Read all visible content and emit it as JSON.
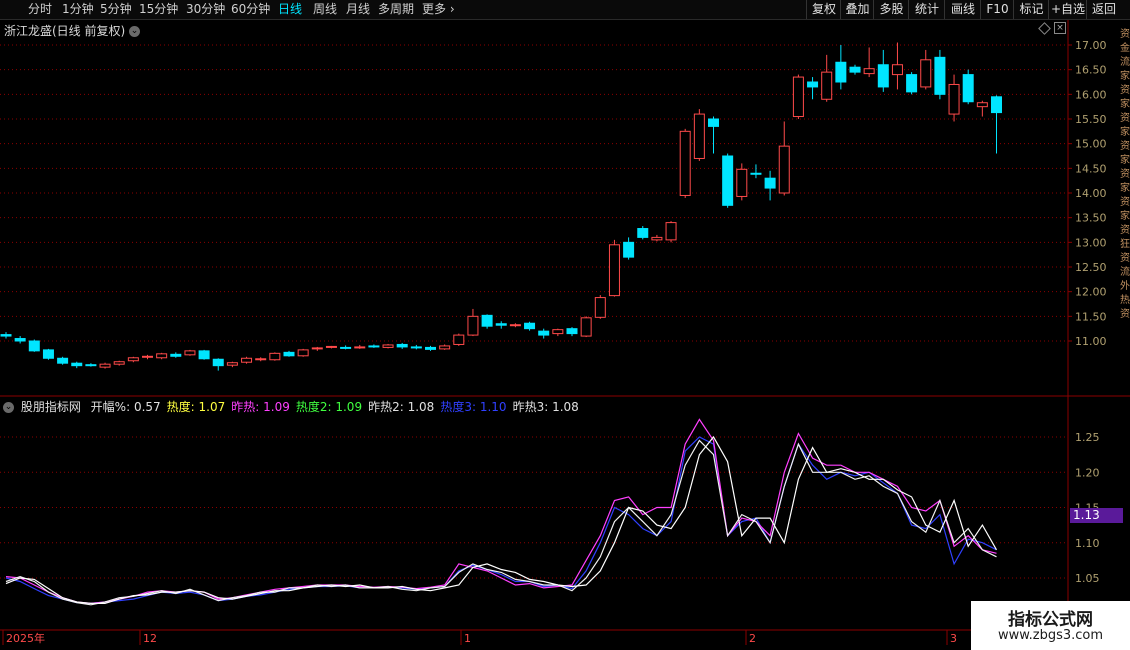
{
  "toolbar": {
    "tabs": [
      "分时",
      "1分钟",
      "5分钟",
      "15分钟",
      "30分钟",
      "60分钟",
      "日线",
      "周线",
      "月线",
      "多周期",
      "更多"
    ],
    "active_tab": "日线",
    "right_buttons": [
      "复权",
      "叠加",
      "多股",
      "统计",
      "画线",
      "F10",
      "标记",
      "+自选",
      "返回"
    ]
  },
  "title": "浙江龙盛(日线 前复权)",
  "indicator": {
    "name": "股朋指标网",
    "items": [
      {
        "label": "开幅%:",
        "value": "0.57",
        "color": "#e0e0e0"
      },
      {
        "label": "热度:",
        "value": "1.07",
        "color": "#ffff40"
      },
      {
        "label": "昨热:",
        "value": "1.09",
        "color": "#ff40ff"
      },
      {
        "label": "热度2:",
        "value": "1.09",
        "color": "#40ff40"
      },
      {
        "label": "昨热2:",
        "value": "1.08",
        "color": "#e0e0e0"
      },
      {
        "label": "热度3:",
        "value": "1.10",
        "color": "#3040ff"
      },
      {
        "label": "昨热3:",
        "value": "1.08",
        "color": "#e0e0e0"
      }
    ],
    "badge": "1.13"
  },
  "price_axis": [
    "17.00",
    "16.50",
    "16.00",
    "15.50",
    "15.00",
    "14.50",
    "14.00",
    "13.50",
    "13.00",
    "12.50",
    "12.00",
    "11.50",
    "11.00"
  ],
  "ind_axis": [
    "1.25",
    "1.20",
    "1.15",
    "1.10",
    "1.05"
  ],
  "date_axis": [
    "2025年",
    "12",
    "1",
    "2",
    "3"
  ],
  "right_strip": "资金流家资家资家资家资家资家资狂资流外热资",
  "watermark": {
    "line1": "指标公式网",
    "line2": "www.zbgs3.com"
  },
  "colors": {
    "up": "#ff4a4a",
    "down": "#00e5ff",
    "grid": "#8b0000",
    "axis": "#b0a070"
  },
  "chart_data": [
    {
      "type": "candlestick",
      "title": "浙江龙盛(日线 前复权)",
      "ylim": [
        10.0,
        17.2
      ],
      "candles": [
        [
          11.13,
          11.1,
          11.18,
          11.05
        ],
        [
          11.05,
          11.0,
          11.1,
          10.95
        ],
        [
          11.0,
          10.8,
          11.03,
          10.78
        ],
        [
          10.82,
          10.65,
          10.84,
          10.62
        ],
        [
          10.65,
          10.55,
          10.68,
          10.52
        ],
        [
          10.55,
          10.5,
          10.58,
          10.45
        ],
        [
          10.52,
          10.51,
          10.55,
          10.48
        ],
        [
          10.47,
          10.53,
          10.56,
          10.44
        ],
        [
          10.53,
          10.58,
          10.6,
          10.5
        ],
        [
          10.6,
          10.66,
          10.68,
          10.57
        ],
        [
          10.67,
          10.69,
          10.72,
          10.63
        ],
        [
          10.66,
          10.74,
          10.76,
          10.63
        ],
        [
          10.73,
          10.69,
          10.77,
          10.66
        ],
        [
          10.72,
          10.8,
          10.82,
          10.7
        ],
        [
          10.8,
          10.64,
          10.82,
          10.62
        ],
        [
          10.63,
          10.5,
          10.65,
          10.4
        ],
        [
          10.51,
          10.56,
          10.58,
          10.47
        ],
        [
          10.57,
          10.65,
          10.68,
          10.54
        ],
        [
          10.62,
          10.64,
          10.67,
          10.59
        ],
        [
          10.62,
          10.75,
          10.77,
          10.6
        ],
        [
          10.77,
          10.7,
          10.8,
          10.68
        ],
        [
          10.7,
          10.82,
          10.84,
          10.68
        ],
        [
          10.84,
          10.86,
          10.88,
          10.8
        ],
        [
          10.88,
          10.89,
          10.9,
          10.85
        ],
        [
          10.87,
          10.86,
          10.91,
          10.83
        ],
        [
          10.86,
          10.88,
          10.92,
          10.84
        ],
        [
          10.9,
          10.89,
          10.93,
          10.86
        ],
        [
          10.87,
          10.92,
          10.94,
          10.85
        ],
        [
          10.93,
          10.88,
          10.96,
          10.84
        ],
        [
          10.88,
          10.86,
          10.92,
          10.83
        ],
        [
          10.87,
          10.83,
          10.9,
          10.8
        ],
        [
          10.84,
          10.9,
          10.93,
          10.82
        ],
        [
          10.93,
          11.12,
          11.15,
          10.9
        ],
        [
          11.12,
          11.5,
          11.65,
          11.1
        ],
        [
          11.52,
          11.3,
          11.54,
          11.25
        ],
        [
          11.35,
          11.32,
          11.4,
          11.25
        ],
        [
          11.32,
          11.33,
          11.36,
          11.28
        ],
        [
          11.36,
          11.25,
          11.39,
          11.21
        ],
        [
          11.2,
          11.12,
          11.25,
          11.05
        ],
        [
          11.15,
          11.23,
          11.25,
          11.1
        ],
        [
          11.25,
          11.15,
          11.28,
          11.1
        ],
        [
          11.1,
          11.47,
          11.5,
          11.08
        ],
        [
          11.48,
          11.88,
          11.93,
          11.45
        ],
        [
          11.92,
          12.95,
          13.05,
          11.9
        ],
        [
          13.0,
          12.7,
          13.1,
          12.65
        ],
        [
          13.28,
          13.1,
          13.33,
          13.06
        ],
        [
          13.05,
          13.1,
          13.15,
          13.02
        ],
        [
          13.05,
          13.4,
          13.43,
          13.0
        ],
        [
          13.95,
          15.25,
          15.3,
          13.9
        ],
        [
          14.7,
          15.6,
          15.7,
          14.65
        ],
        [
          15.5,
          15.35,
          15.55,
          14.8
        ],
        [
          14.75,
          13.75,
          14.8,
          13.7
        ],
        [
          13.93,
          14.48,
          14.6,
          13.85
        ],
        [
          14.4,
          14.38,
          14.58,
          14.3
        ],
        [
          14.3,
          14.1,
          14.45,
          13.85
        ],
        [
          14.0,
          14.95,
          15.45,
          13.95
        ],
        [
          15.55,
          16.35,
          16.4,
          15.5
        ],
        [
          16.25,
          16.15,
          16.35,
          15.9
        ],
        [
          15.9,
          16.45,
          16.8,
          15.85
        ],
        [
          16.65,
          16.25,
          17.0,
          16.1
        ],
        [
          16.55,
          16.45,
          16.6,
          16.4
        ],
        [
          16.42,
          16.52,
          16.95,
          16.35
        ],
        [
          16.6,
          16.15,
          16.9,
          16.05
        ],
        [
          16.4,
          16.6,
          17.05,
          16.1
        ],
        [
          16.4,
          16.05,
          16.45,
          16.0
        ],
        [
          16.15,
          16.7,
          16.9,
          16.1
        ],
        [
          16.75,
          16.0,
          16.9,
          15.9
        ],
        [
          15.6,
          16.2,
          16.4,
          15.45
        ],
        [
          16.4,
          15.85,
          16.5,
          15.8
        ],
        [
          15.75,
          15.83,
          15.87,
          15.55
        ],
        [
          15.95,
          15.63,
          15.98,
          14.8
        ]
      ]
    },
    {
      "type": "line",
      "title": "股朋指标网",
      "ylim": [
        1.005,
        1.29
      ],
      "series": [
        {
          "name": "热度",
          "color": "#3040ff",
          "values": [
            1.05,
            1.045,
            1.035,
            1.025,
            1.02,
            1.015,
            1.014,
            1.016,
            1.018,
            1.02,
            1.025,
            1.03,
            1.028,
            1.03,
            1.026,
            1.018,
            1.02,
            1.024,
            1.026,
            1.03,
            1.034,
            1.036,
            1.038,
            1.038,
            1.039,
            1.036,
            1.036,
            1.037,
            1.036,
            1.034,
            1.036,
            1.038,
            1.06,
            1.068,
            1.062,
            1.055,
            1.045,
            1.045,
            1.038,
            1.04,
            1.035,
            1.06,
            1.1,
            1.15,
            1.14,
            1.12,
            1.11,
            1.13,
            1.23,
            1.25,
            1.24,
            1.11,
            1.13,
            1.135,
            1.1,
            1.18,
            1.24,
            1.21,
            1.19,
            1.2,
            1.195,
            1.2,
            1.185,
            1.17,
            1.125,
            1.12,
            1.14,
            1.07,
            1.105,
            1.1,
            1.09
          ]
        },
        {
          "name": "昨热",
          "color": "#ff40ff",
          "values": [
            1.052,
            1.05,
            1.04,
            1.03,
            1.022,
            1.016,
            1.014,
            1.016,
            1.02,
            1.024,
            1.03,
            1.032,
            1.03,
            1.032,
            1.03,
            1.02,
            1.022,
            1.026,
            1.03,
            1.034,
            1.036,
            1.038,
            1.04,
            1.04,
            1.04,
            1.038,
            1.037,
            1.038,
            1.037,
            1.035,
            1.037,
            1.04,
            1.07,
            1.065,
            1.06,
            1.05,
            1.04,
            1.042,
            1.036,
            1.038,
            1.04,
            1.075,
            1.11,
            1.16,
            1.165,
            1.14,
            1.15,
            1.15,
            1.24,
            1.275,
            1.245,
            1.11,
            1.135,
            1.13,
            1.11,
            1.2,
            1.255,
            1.22,
            1.21,
            1.21,
            1.2,
            1.2,
            1.19,
            1.18,
            1.15,
            1.145,
            1.16,
            1.095,
            1.11,
            1.09,
            1.085
          ]
        },
        {
          "name": "热度2",
          "color": "#f0f0f0",
          "values": [
            1.045,
            1.052,
            1.045,
            1.03,
            1.02,
            1.015,
            1.012,
            1.016,
            1.022,
            1.024,
            1.028,
            1.032,
            1.028,
            1.034,
            1.026,
            1.018,
            1.022,
            1.025,
            1.03,
            1.03,
            1.036,
            1.036,
            1.04,
            1.038,
            1.04,
            1.036,
            1.036,
            1.038,
            1.034,
            1.032,
            1.036,
            1.038,
            1.058,
            1.07,
            1.062,
            1.058,
            1.048,
            1.045,
            1.04,
            1.04,
            1.032,
            1.05,
            1.08,
            1.13,
            1.15,
            1.13,
            1.11,
            1.14,
            1.21,
            1.245,
            1.225,
            1.11,
            1.14,
            1.13,
            1.1,
            1.18,
            1.24,
            1.2,
            1.2,
            1.2,
            1.19,
            1.195,
            1.18,
            1.17,
            1.13,
            1.115,
            1.16,
            1.1,
            1.12,
            1.09,
            1.08
          ]
        },
        {
          "name": "昨热2",
          "color": "#ffffff",
          "values": [
            1.042,
            1.05,
            1.048,
            1.035,
            1.022,
            1.016,
            1.014,
            1.014,
            1.02,
            1.025,
            1.026,
            1.03,
            1.03,
            1.032,
            1.03,
            1.022,
            1.02,
            1.024,
            1.028,
            1.032,
            1.032,
            1.036,
            1.038,
            1.04,
            1.038,
            1.04,
            1.036,
            1.036,
            1.038,
            1.034,
            1.032,
            1.036,
            1.04,
            1.065,
            1.07,
            1.062,
            1.058,
            1.048,
            1.045,
            1.04,
            1.038,
            1.04,
            1.06,
            1.1,
            1.15,
            1.145,
            1.125,
            1.12,
            1.15,
            1.225,
            1.25,
            1.215,
            1.11,
            1.135,
            1.135,
            1.1,
            1.19,
            1.235,
            1.2,
            1.205,
            1.2,
            1.19,
            1.19,
            1.175,
            1.165,
            1.125,
            1.115,
            1.16,
            1.095,
            1.125,
            1.09
          ]
        }
      ]
    }
  ]
}
